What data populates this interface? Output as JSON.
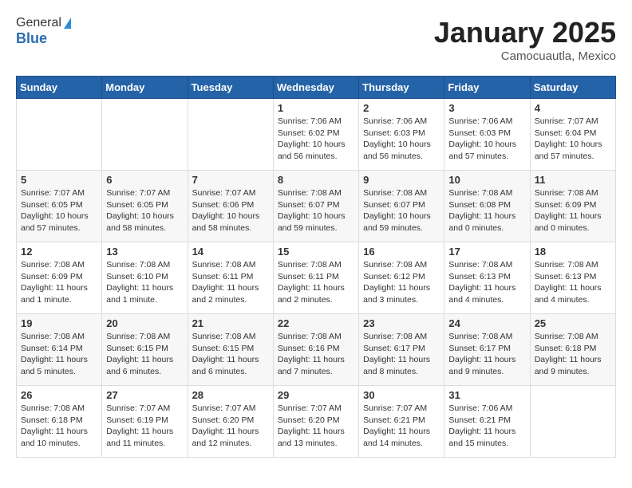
{
  "logo": {
    "line1": "General",
    "line2": "Blue"
  },
  "title": "January 2025",
  "location": "Camocuautla, Mexico",
  "weekdays": [
    "Sunday",
    "Monday",
    "Tuesday",
    "Wednesday",
    "Thursday",
    "Friday",
    "Saturday"
  ],
  "weeks": [
    [
      {
        "day": "",
        "info": ""
      },
      {
        "day": "",
        "info": ""
      },
      {
        "day": "",
        "info": ""
      },
      {
        "day": "1",
        "info": "Sunrise: 7:06 AM\nSunset: 6:02 PM\nDaylight: 10 hours\nand 56 minutes."
      },
      {
        "day": "2",
        "info": "Sunrise: 7:06 AM\nSunset: 6:03 PM\nDaylight: 10 hours\nand 56 minutes."
      },
      {
        "day": "3",
        "info": "Sunrise: 7:06 AM\nSunset: 6:03 PM\nDaylight: 10 hours\nand 57 minutes."
      },
      {
        "day": "4",
        "info": "Sunrise: 7:07 AM\nSunset: 6:04 PM\nDaylight: 10 hours\nand 57 minutes."
      }
    ],
    [
      {
        "day": "5",
        "info": "Sunrise: 7:07 AM\nSunset: 6:05 PM\nDaylight: 10 hours\nand 57 minutes."
      },
      {
        "day": "6",
        "info": "Sunrise: 7:07 AM\nSunset: 6:05 PM\nDaylight: 10 hours\nand 58 minutes."
      },
      {
        "day": "7",
        "info": "Sunrise: 7:07 AM\nSunset: 6:06 PM\nDaylight: 10 hours\nand 58 minutes."
      },
      {
        "day": "8",
        "info": "Sunrise: 7:08 AM\nSunset: 6:07 PM\nDaylight: 10 hours\nand 59 minutes."
      },
      {
        "day": "9",
        "info": "Sunrise: 7:08 AM\nSunset: 6:07 PM\nDaylight: 10 hours\nand 59 minutes."
      },
      {
        "day": "10",
        "info": "Sunrise: 7:08 AM\nSunset: 6:08 PM\nDaylight: 11 hours\nand 0 minutes."
      },
      {
        "day": "11",
        "info": "Sunrise: 7:08 AM\nSunset: 6:09 PM\nDaylight: 11 hours\nand 0 minutes."
      }
    ],
    [
      {
        "day": "12",
        "info": "Sunrise: 7:08 AM\nSunset: 6:09 PM\nDaylight: 11 hours\nand 1 minute."
      },
      {
        "day": "13",
        "info": "Sunrise: 7:08 AM\nSunset: 6:10 PM\nDaylight: 11 hours\nand 1 minute."
      },
      {
        "day": "14",
        "info": "Sunrise: 7:08 AM\nSunset: 6:11 PM\nDaylight: 11 hours\nand 2 minutes."
      },
      {
        "day": "15",
        "info": "Sunrise: 7:08 AM\nSunset: 6:11 PM\nDaylight: 11 hours\nand 2 minutes."
      },
      {
        "day": "16",
        "info": "Sunrise: 7:08 AM\nSunset: 6:12 PM\nDaylight: 11 hours\nand 3 minutes."
      },
      {
        "day": "17",
        "info": "Sunrise: 7:08 AM\nSunset: 6:13 PM\nDaylight: 11 hours\nand 4 minutes."
      },
      {
        "day": "18",
        "info": "Sunrise: 7:08 AM\nSunset: 6:13 PM\nDaylight: 11 hours\nand 4 minutes."
      }
    ],
    [
      {
        "day": "19",
        "info": "Sunrise: 7:08 AM\nSunset: 6:14 PM\nDaylight: 11 hours\nand 5 minutes."
      },
      {
        "day": "20",
        "info": "Sunrise: 7:08 AM\nSunset: 6:15 PM\nDaylight: 11 hours\nand 6 minutes."
      },
      {
        "day": "21",
        "info": "Sunrise: 7:08 AM\nSunset: 6:15 PM\nDaylight: 11 hours\nand 6 minutes."
      },
      {
        "day": "22",
        "info": "Sunrise: 7:08 AM\nSunset: 6:16 PM\nDaylight: 11 hours\nand 7 minutes."
      },
      {
        "day": "23",
        "info": "Sunrise: 7:08 AM\nSunset: 6:17 PM\nDaylight: 11 hours\nand 8 minutes."
      },
      {
        "day": "24",
        "info": "Sunrise: 7:08 AM\nSunset: 6:17 PM\nDaylight: 11 hours\nand 9 minutes."
      },
      {
        "day": "25",
        "info": "Sunrise: 7:08 AM\nSunset: 6:18 PM\nDaylight: 11 hours\nand 9 minutes."
      }
    ],
    [
      {
        "day": "26",
        "info": "Sunrise: 7:08 AM\nSunset: 6:18 PM\nDaylight: 11 hours\nand 10 minutes."
      },
      {
        "day": "27",
        "info": "Sunrise: 7:07 AM\nSunset: 6:19 PM\nDaylight: 11 hours\nand 11 minutes."
      },
      {
        "day": "28",
        "info": "Sunrise: 7:07 AM\nSunset: 6:20 PM\nDaylight: 11 hours\nand 12 minutes."
      },
      {
        "day": "29",
        "info": "Sunrise: 7:07 AM\nSunset: 6:20 PM\nDaylight: 11 hours\nand 13 minutes."
      },
      {
        "day": "30",
        "info": "Sunrise: 7:07 AM\nSunset: 6:21 PM\nDaylight: 11 hours\nand 14 minutes."
      },
      {
        "day": "31",
        "info": "Sunrise: 7:06 AM\nSunset: 6:21 PM\nDaylight: 11 hours\nand 15 minutes."
      },
      {
        "day": "",
        "info": ""
      }
    ]
  ]
}
